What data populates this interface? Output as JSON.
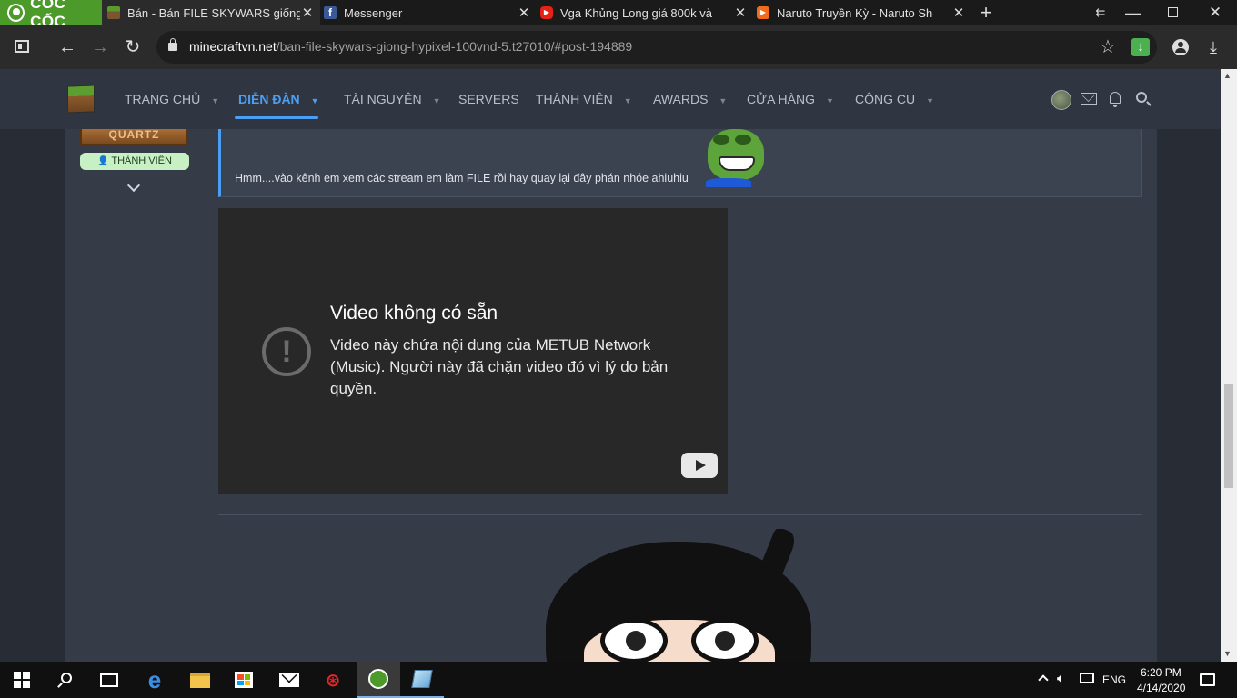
{
  "browser": {
    "brand": "CỐC CỐC",
    "tabs": [
      {
        "title": "Bán - Bán FILE SKYWARS giống",
        "active": true,
        "icon": "minecraft-icon"
      },
      {
        "title": "Messenger",
        "active": false,
        "icon": "facebook-icon"
      },
      {
        "title": "Vga Khủng Long giá 800k và",
        "active": false,
        "icon": "youtube-icon"
      },
      {
        "title": "Naruto Truyền Kỳ - Naruto Sh",
        "active": false,
        "icon": "play-icon"
      }
    ],
    "url_domain": "minecraftvn.net",
    "url_path": "/ban-file-skywars-giong-hypixel-100vnd-5.t27010/#post-194889"
  },
  "site_nav": {
    "items": [
      {
        "label": "TRANG CHỦ",
        "dropdown": true,
        "active": false
      },
      {
        "label": "DIỄN ĐÀN",
        "dropdown": true,
        "active": true
      },
      {
        "label": "TÀI NGUYÊN",
        "dropdown": true,
        "active": false
      },
      {
        "label": "SERVERS",
        "dropdown": false,
        "active": false
      },
      {
        "label": "THÀNH VIÊN",
        "dropdown": true,
        "active": false
      },
      {
        "label": "AWARDS",
        "dropdown": true,
        "active": false
      },
      {
        "label": "CỬA HÀNG",
        "dropdown": true,
        "active": false
      },
      {
        "label": "CÔNG CỤ",
        "dropdown": true,
        "active": false
      }
    ]
  },
  "post": {
    "user_badge_text": "QUARTZ",
    "user_role": "THÀNH VIÊN",
    "quote_text": "Hmm....vào kênh em xem các stream em làm FILE rồi hay quay lại đây phán nhóe ahiuhiu",
    "video": {
      "title": "Video không có sẵn",
      "message": "Video này chứa nội dung của METUB Network (Music). Người này đã chặn video đó vì lý do bản quyền."
    }
  },
  "taskbar": {
    "language": "ENG",
    "time": "6:20 PM",
    "date": "4/14/2020"
  },
  "colors": {
    "accent": "#4a9ff5",
    "nav_bg": "#2f3642",
    "page_bg": "#353c48",
    "role_badge": "#c7f0c4"
  }
}
